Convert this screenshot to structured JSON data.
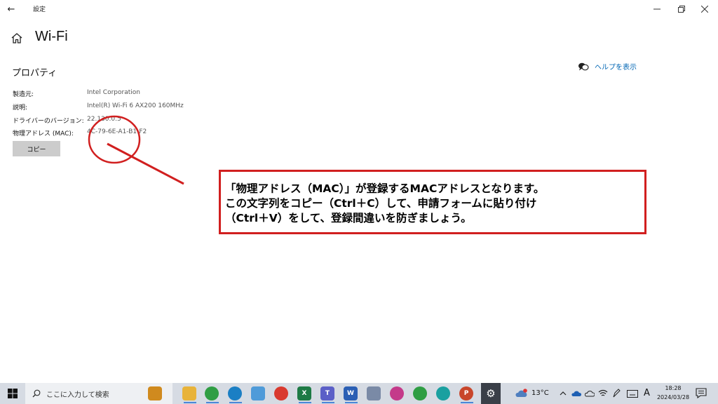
{
  "window": {
    "title": "設定",
    "back_glyph": "←",
    "min_glyph": "—",
    "max_glyph": "❐",
    "close_glyph": "✕"
  },
  "header": {
    "title": "Wi-Fi",
    "help_text": "ヘルプを表示"
  },
  "properties": {
    "section_title": "プロパティ",
    "rows": [
      {
        "label": "製造元:",
        "value": "Intel Corporation"
      },
      {
        "label": "説明:",
        "value": "Intel(R) Wi-Fi 6 AX200 160MHz"
      },
      {
        "label": "ドライバーのバージョン:",
        "value": "22.130.0.5"
      },
      {
        "label": "物理アドレス (MAC):",
        "value": "4C-79-6E-A1-B1-F2"
      }
    ],
    "copy_label": "コピー"
  },
  "annotation": {
    "lines": [
      "「物理アドレス（MAC）」が登録するMACアドレスとなります。",
      "この文字列をコピー（Ctrl＋C）して、申請フォームに貼り付け",
      "（Ctrl＋V）をして、登録間違いを防ぎましょう。"
    ],
    "color": "#d11f1f"
  },
  "taskbar": {
    "search_placeholder": "ここに入力して検索",
    "apps": [
      {
        "name": "briefcase-app",
        "color": "#d08a1e",
        "glyph": ""
      },
      {
        "name": "file-explorer",
        "color": "#e8b33a",
        "glyph": ""
      },
      {
        "name": "chrome-app",
        "color": "#2f9e44",
        "glyph": ""
      },
      {
        "name": "edge-app",
        "color": "#1b7fc4",
        "glyph": ""
      },
      {
        "name": "notepad-app",
        "color": "#4f9bd9",
        "glyph": ""
      },
      {
        "name": "chrome-app-2",
        "color": "#d93a2f",
        "glyph": ""
      },
      {
        "name": "excel-app",
        "color": "#1d7a45",
        "glyph": "X"
      },
      {
        "name": "teams-app",
        "color": "#5b5fc7",
        "glyph": "T"
      },
      {
        "name": "word-app",
        "color": "#2b5fb4",
        "glyph": "W"
      },
      {
        "name": "paint-app",
        "color": "#7a8aa6",
        "glyph": ""
      },
      {
        "name": "chrome-app-3",
        "color": "#c43a8a",
        "glyph": ""
      },
      {
        "name": "chrome-app-4",
        "color": "#2f9e44",
        "glyph": ""
      },
      {
        "name": "edge-app-2",
        "color": "#1aa0a0",
        "glyph": ""
      },
      {
        "name": "powerpoint-app",
        "color": "#c8462b",
        "glyph": "P"
      },
      {
        "name": "settings-app",
        "color": "#3a3f48",
        "glyph": "⚙"
      }
    ],
    "weather_temp": "13°C",
    "ime_indicator": "A",
    "clock_time": "18:28",
    "clock_date": "2024/03/28"
  }
}
